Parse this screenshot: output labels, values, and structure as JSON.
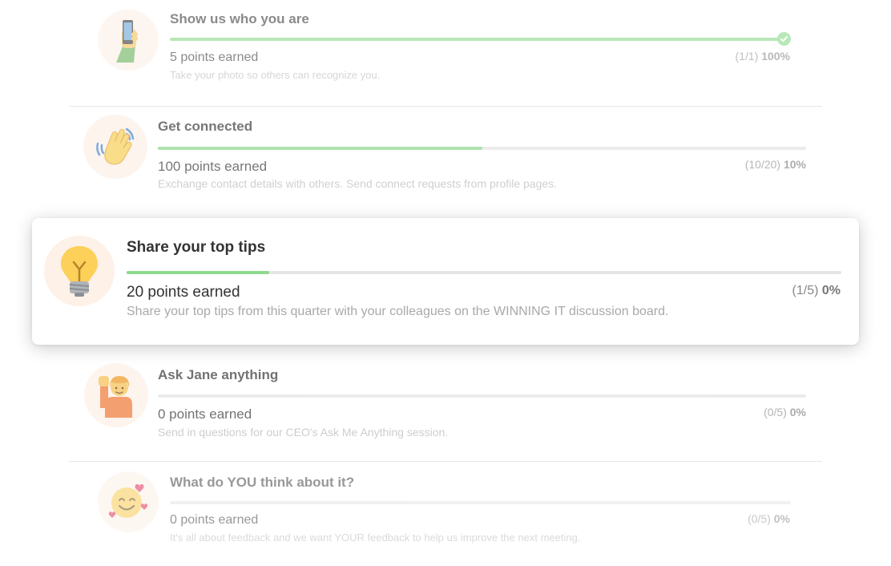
{
  "accent_color": "#8ed98e",
  "tasks": [
    {
      "title": "Show us who you are",
      "points": "5 points earned",
      "description": "Take your photo so others can recognize you.",
      "count": "(1/1)",
      "percent": "100%",
      "progress": 1.0,
      "completed": true,
      "icon": "phone-in-hand-icon"
    },
    {
      "title": "Get connected",
      "points": "100 points earned",
      "description": "Exchange contact details with others. Send connect requests from profile pages.",
      "count": "(10/20)",
      "percent": "10%",
      "progress": 0.5,
      "completed": false,
      "icon": "waving-hand-icon"
    },
    {
      "title": "Share your top tips",
      "points": "20 points earned",
      "description": "Share your top tips from this quarter with your colleagues on the WINNING IT discussion board.",
      "count": "(1/5)",
      "percent": "0%",
      "progress": 0.2,
      "completed": false,
      "icon": "light-bulb-icon"
    },
    {
      "title": "Ask Jane anything",
      "points": "0 points earned",
      "description": "Send in questions for our CEO's Ask Me Anything session.",
      "count": "(0/5)",
      "percent": "0%",
      "progress": 0,
      "completed": false,
      "icon": "person-raising-hand-icon"
    },
    {
      "title": "What do YOU think about it?",
      "points": "0 points earned",
      "description": "It's all about feedback and we want YOUR feedback to help us improve the next meeting.",
      "count": "(0/5)",
      "percent": "0%",
      "progress": 0,
      "completed": false,
      "icon": "smiling-face-with-hearts-icon"
    }
  ]
}
